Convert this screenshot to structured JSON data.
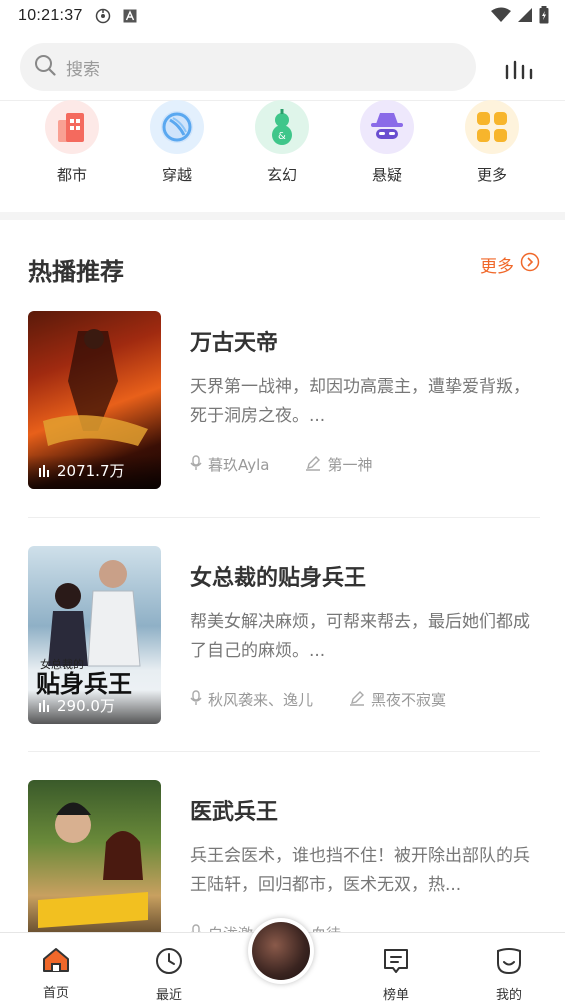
{
  "status_bar": {
    "time": "10:21:37"
  },
  "search": {
    "placeholder": "搜索"
  },
  "categories": [
    {
      "label": "都市",
      "icon": "building-icon",
      "color": "#f46a5e"
    },
    {
      "label": "穿越",
      "icon": "portal-icon",
      "color": "#5aa8f0"
    },
    {
      "label": "玄幻",
      "icon": "gourd-icon",
      "color": "#3fc68a"
    },
    {
      "label": "悬疑",
      "icon": "detective-icon",
      "color": "#8a6ae8"
    },
    {
      "label": "更多",
      "icon": "grid-more-icon",
      "color": "#f7b52c"
    }
  ],
  "section": {
    "title": "热播推荐",
    "more_label": "更多"
  },
  "books": [
    {
      "title": "万古天帝",
      "description": "天界第一战神，却因功高震主，遭挚爱背叛，死于洞房之夜。...",
      "plays": "2071.7万",
      "narrator": "暮玖Ayla",
      "author": "第一神"
    },
    {
      "title": "女总裁的贴身兵王",
      "description": "帮美女解决麻烦，可帮来帮去，最后她们都成了自己的麻烦。...",
      "plays": "290.0万",
      "narrator": "秋风袭来、逸儿",
      "author": "黑夜不寂寞"
    },
    {
      "title": "医武兵王",
      "description": "兵王会医术，谁也挡不住！被开除出部队的兵王陆轩，回归都市，医术无双，热...",
      "plays": "",
      "narrator": "白泷激",
      "author": "血徒"
    }
  ],
  "tabbar": {
    "home": "首页",
    "recent": "最近",
    "rank": "榜单",
    "mine": "我的"
  },
  "colors": {
    "accent": "#f0682a"
  }
}
